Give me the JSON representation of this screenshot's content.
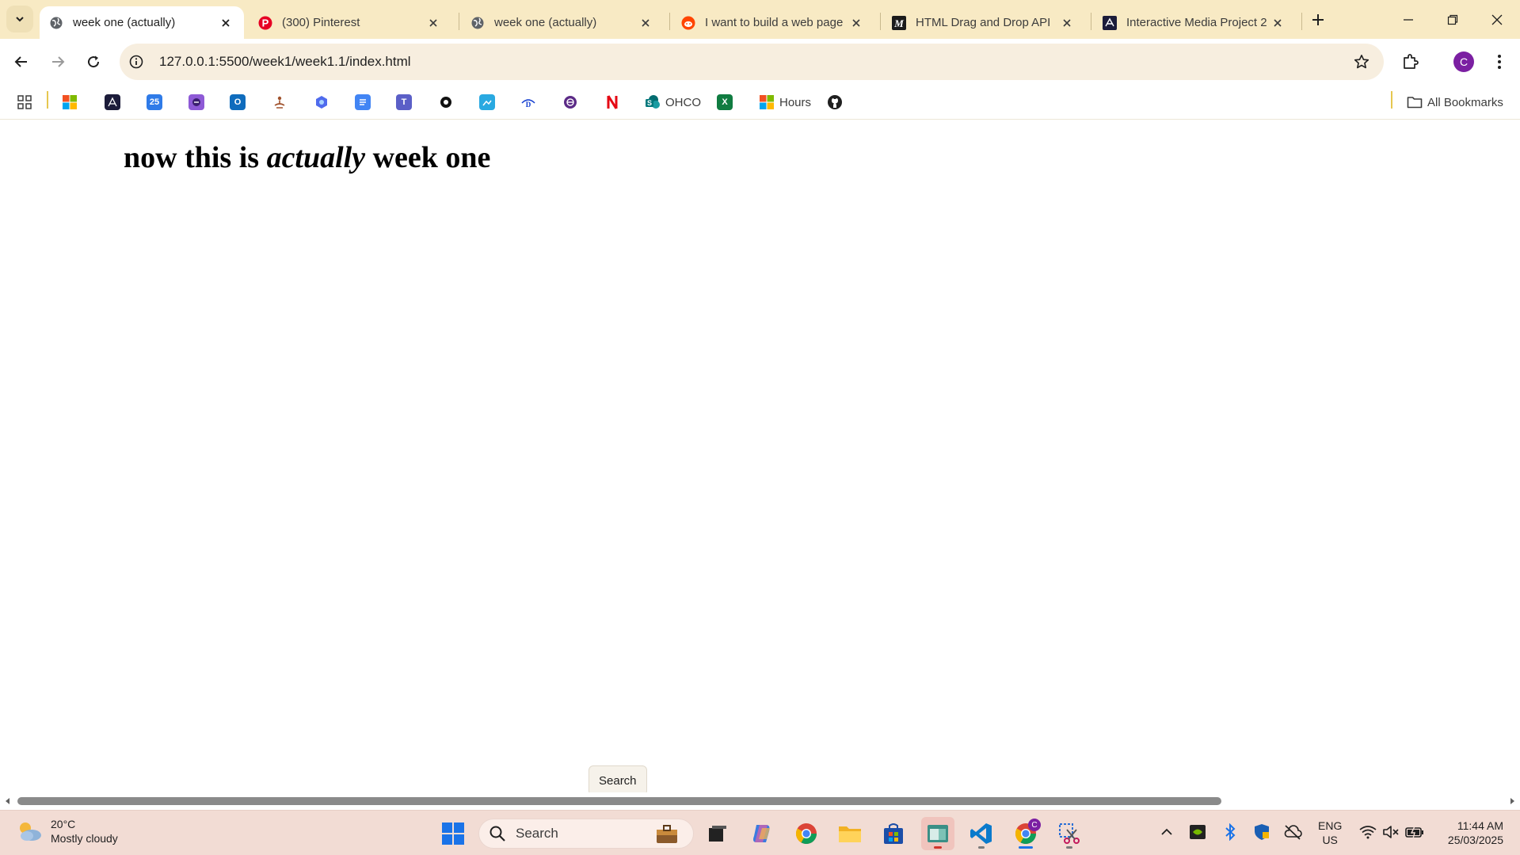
{
  "tabs": [
    {
      "title": "week one (actually)",
      "icon": "globe-icon",
      "active": true
    },
    {
      "title": "(300) Pinterest",
      "icon": "pinterest-icon",
      "active": false
    },
    {
      "title": "week one (actually)",
      "icon": "globe-icon",
      "active": false
    },
    {
      "title": "I want to build a web page",
      "icon": "reddit-icon",
      "active": false
    },
    {
      "title": "HTML Drag and Drop API",
      "icon": "mdn-icon",
      "active": false
    },
    {
      "title": "Interactive Media Project 2",
      "icon": "institution-icon",
      "active": false
    }
  ],
  "toolbar": {
    "url": "127.0.0.1:5500/week1/week1.1/index.html",
    "profile_initial": "C"
  },
  "bookmarks": {
    "items": [
      {
        "label": "",
        "icon": "apps-grid-icon"
      },
      {
        "label": "",
        "icon": "microsoft-icon"
      },
      {
        "label": "",
        "icon": "institution-icon"
      },
      {
        "label": "",
        "icon": "calendar-icon"
      },
      {
        "label": "",
        "icon": "purple-app-icon"
      },
      {
        "label": "",
        "icon": "outlook-icon"
      },
      {
        "label": "",
        "icon": "meditation-icon"
      },
      {
        "label": "",
        "icon": "hexagon-app-icon"
      },
      {
        "label": "",
        "icon": "docs-icon"
      },
      {
        "label": "",
        "icon": "teams-icon"
      },
      {
        "label": "",
        "icon": "circle-app-icon"
      },
      {
        "label": "",
        "icon": "image-app-icon"
      },
      {
        "label": "",
        "icon": "disney-icon"
      },
      {
        "label": "",
        "icon": "purple-circle-icon"
      },
      {
        "label": "",
        "icon": "netflix-icon"
      },
      {
        "label": "OHCO",
        "icon": "sharepoint-icon"
      },
      {
        "label": "",
        "icon": "excel-icon"
      },
      {
        "label": "Hours",
        "icon": "microsoft-icon"
      },
      {
        "label": "",
        "icon": "github-icon"
      }
    ],
    "all_bookmarks_label": "All Bookmarks"
  },
  "page": {
    "heading_before": "now this is ",
    "heading_em": "actually",
    "heading_after": " week one"
  },
  "tooltip": {
    "text": "Search"
  },
  "taskbar": {
    "weather_temp": "20°C",
    "weather_desc": "Mostly cloudy",
    "search_label": "Search",
    "lang_line1": "ENG",
    "lang_line2": "US",
    "time": "11:44 AM",
    "date": "25/03/2025"
  },
  "colors": {
    "tabstrip": "#f8eac4",
    "omnibox": "#f7eedf",
    "taskbar": "#f2dcd4",
    "profile": "#7b1fa2"
  }
}
